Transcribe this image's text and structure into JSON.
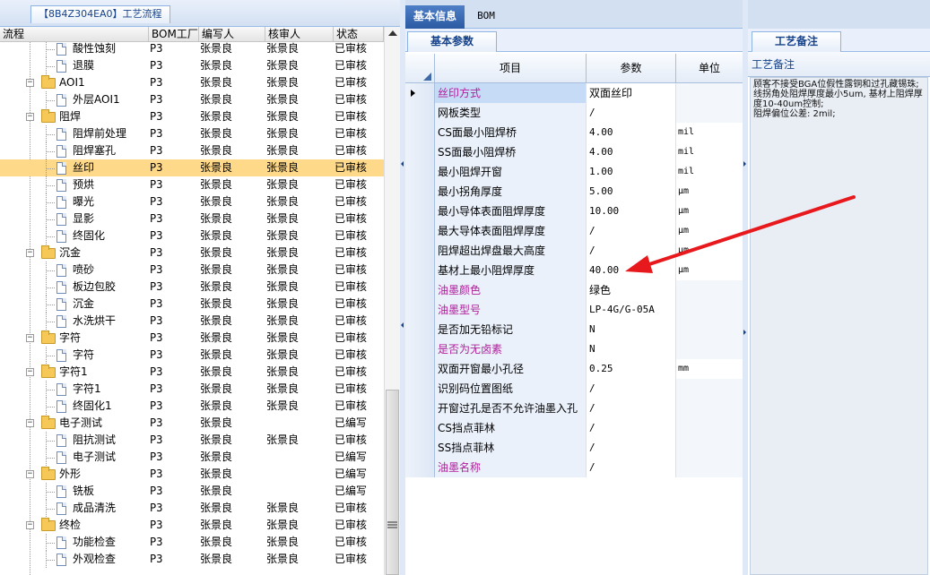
{
  "left_panel": {
    "tab_label": "【8B4Z304EA0】工艺流程",
    "columns": {
      "flow": "流程",
      "bom": "BOM工厂",
      "writer": "编写人",
      "reviewer": "核审人",
      "status": "状态"
    },
    "rows": [
      {
        "label": "酸性蚀刻",
        "type": "file",
        "bom": "P3",
        "writer": "张景良",
        "reviewer": "张景良",
        "status": "已审核"
      },
      {
        "label": "退膜",
        "type": "file",
        "bom": "P3",
        "writer": "张景良",
        "reviewer": "张景良",
        "status": "已审核"
      },
      {
        "label": "AOI1",
        "type": "folder",
        "bom": "P3",
        "writer": "张景良",
        "reviewer": "张景良",
        "status": "已审核"
      },
      {
        "label": "外层AOI1",
        "type": "file",
        "bom": "P3",
        "writer": "张景良",
        "reviewer": "张景良",
        "status": "已审核"
      },
      {
        "label": "阻焊",
        "type": "folder",
        "bom": "P3",
        "writer": "张景良",
        "reviewer": "张景良",
        "status": "已审核"
      },
      {
        "label": "阻焊前处理",
        "type": "file",
        "bom": "P3",
        "writer": "张景良",
        "reviewer": "张景良",
        "status": "已审核"
      },
      {
        "label": "阻焊塞孔",
        "type": "file",
        "bom": "P3",
        "writer": "张景良",
        "reviewer": "张景良",
        "status": "已审核"
      },
      {
        "label": "丝印",
        "type": "file",
        "bom": "P3",
        "writer": "张景良",
        "reviewer": "张景良",
        "status": "已审核",
        "selected": true
      },
      {
        "label": "预烘",
        "type": "file",
        "bom": "P3",
        "writer": "张景良",
        "reviewer": "张景良",
        "status": "已审核"
      },
      {
        "label": "曝光",
        "type": "file",
        "bom": "P3",
        "writer": "张景良",
        "reviewer": "张景良",
        "status": "已审核"
      },
      {
        "label": "显影",
        "type": "file",
        "bom": "P3",
        "writer": "张景良",
        "reviewer": "张景良",
        "status": "已审核"
      },
      {
        "label": "终固化",
        "type": "file",
        "bom": "P3",
        "writer": "张景良",
        "reviewer": "张景良",
        "status": "已审核"
      },
      {
        "label": "沉金",
        "type": "folder",
        "bom": "P3",
        "writer": "张景良",
        "reviewer": "张景良",
        "status": "已审核"
      },
      {
        "label": "喷砂",
        "type": "file",
        "bom": "P3",
        "writer": "张景良",
        "reviewer": "张景良",
        "status": "已审核"
      },
      {
        "label": "板边包胶",
        "type": "file",
        "bom": "P3",
        "writer": "张景良",
        "reviewer": "张景良",
        "status": "已审核"
      },
      {
        "label": "沉金",
        "type": "file",
        "bom": "P3",
        "writer": "张景良",
        "reviewer": "张景良",
        "status": "已审核"
      },
      {
        "label": "水洗烘干",
        "type": "file",
        "bom": "P3",
        "writer": "张景良",
        "reviewer": "张景良",
        "status": "已审核"
      },
      {
        "label": "字符",
        "type": "folder",
        "bom": "P3",
        "writer": "张景良",
        "reviewer": "张景良",
        "status": "已审核"
      },
      {
        "label": "字符",
        "type": "file",
        "bom": "P3",
        "writer": "张景良",
        "reviewer": "张景良",
        "status": "已审核"
      },
      {
        "label": "字符1",
        "type": "folder",
        "bom": "P3",
        "writer": "张景良",
        "reviewer": "张景良",
        "status": "已审核"
      },
      {
        "label": "字符1",
        "type": "file",
        "bom": "P3",
        "writer": "张景良",
        "reviewer": "张景良",
        "status": "已审核"
      },
      {
        "label": "终固化1",
        "type": "file",
        "bom": "P3",
        "writer": "张景良",
        "reviewer": "张景良",
        "status": "已审核"
      },
      {
        "label": "电子测试",
        "type": "folder",
        "bom": "P3",
        "writer": "张景良",
        "reviewer": "",
        "status": "已编写"
      },
      {
        "label": "阻抗测试",
        "type": "file",
        "bom": "P3",
        "writer": "张景良",
        "reviewer": "张景良",
        "status": "已审核"
      },
      {
        "label": "电子测试",
        "type": "file",
        "bom": "P3",
        "writer": "张景良",
        "reviewer": "",
        "status": "已编写"
      },
      {
        "label": "外形",
        "type": "folder",
        "bom": "P3",
        "writer": "张景良",
        "reviewer": "",
        "status": "已编写"
      },
      {
        "label": "铣板",
        "type": "file",
        "bom": "P3",
        "writer": "张景良",
        "reviewer": "",
        "status": "已编写"
      },
      {
        "label": "成品清洗",
        "type": "file",
        "bom": "P3",
        "writer": "张景良",
        "reviewer": "张景良",
        "status": "已审核"
      },
      {
        "label": "终检",
        "type": "folder",
        "bom": "P3",
        "writer": "张景良",
        "reviewer": "张景良",
        "status": "已审核"
      },
      {
        "label": "功能检查",
        "type": "file",
        "bom": "P3",
        "writer": "张景良",
        "reviewer": "张景良",
        "status": "已审核"
      },
      {
        "label": "外观检查",
        "type": "file",
        "bom": "P3",
        "writer": "张景良",
        "reviewer": "张景良",
        "status": "已审核"
      }
    ]
  },
  "middle_panel": {
    "tabs": [
      {
        "label": "基本信息",
        "active": true
      },
      {
        "label": "BOM",
        "active": false
      }
    ],
    "subtab": "基本参数",
    "columns": {
      "item": "项目",
      "param": "参数",
      "unit": "单位"
    },
    "rows": [
      {
        "item": "丝印方式",
        "param": "双面丝印",
        "unit": "",
        "pink": true,
        "highlight": true,
        "current": true
      },
      {
        "item": "网板类型",
        "param": "/",
        "unit": ""
      },
      {
        "item": "CS面最小阻焊桥",
        "param": "4.00",
        "unit": "mil"
      },
      {
        "item": "SS面最小阻焊桥",
        "param": "4.00",
        "unit": "mil"
      },
      {
        "item": "最小阻焊开窗",
        "param": "1.00",
        "unit": "mil"
      },
      {
        "item": "最小拐角厚度",
        "param": "5.00",
        "unit": "μm"
      },
      {
        "item": "最小导体表面阻焊厚度",
        "param": "10.00",
        "unit": "μm"
      },
      {
        "item": "最大导体表面阻焊厚度",
        "param": "/",
        "unit": "μm"
      },
      {
        "item": "阻焊超出焊盘最大高度",
        "param": "/",
        "unit": "μm"
      },
      {
        "item": "基材上最小阻焊厚度",
        "param": "40.00",
        "unit": "μm"
      },
      {
        "item": "油墨颜色",
        "param": "绿色",
        "unit": "",
        "pink": true
      },
      {
        "item": "油墨型号",
        "param": "LP-4G/G-05A",
        "unit": "",
        "pink": true
      },
      {
        "item": "是否加无铅标记",
        "param": "N",
        "unit": ""
      },
      {
        "item": "是否为无卤素",
        "param": "N",
        "unit": "",
        "pink": true
      },
      {
        "item": "双面开窗最小孔径",
        "param": "0.25",
        "unit": "mm"
      },
      {
        "item": "识别码位置图纸",
        "param": "/",
        "unit": ""
      },
      {
        "item": "开窗过孔是否不允许油墨入孔",
        "param": "/",
        "unit": ""
      },
      {
        "item": "CS挡点菲林",
        "param": "/",
        "unit": ""
      },
      {
        "item": "SS挡点菲林",
        "param": "/",
        "unit": ""
      },
      {
        "item": "油墨名称",
        "param": "/",
        "unit": "",
        "pink": true
      }
    ]
  },
  "right_panel": {
    "tab": "工艺备注",
    "caption": "工艺备注",
    "memo": "顾客不接受BGA位假性露铜和过孔藏锡珠;\n线拐角处阻焊厚度最小5um, 基材上阻焊厚度10-40um控制;\n阻焊偏位公差: 2mil;"
  },
  "colors": {
    "accent": "#2b5aa3",
    "selected_row": "#ffd98a",
    "pink_label": "#b0209b",
    "arrow": "#e8191d"
  }
}
